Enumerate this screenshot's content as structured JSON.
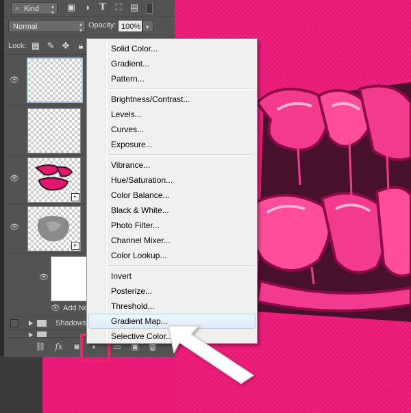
{
  "panel": {
    "filter": {
      "label": "Kind"
    },
    "blend": {
      "mode": "Normal",
      "opacity_label": "Opacity:",
      "opacity_value": "100%"
    },
    "lock": {
      "label": "Lock:"
    },
    "layers": [
      {
        "type": "empty",
        "selected": true
      },
      {
        "type": "empty",
        "selected": false
      },
      {
        "type": "text-art",
        "selected": false
      },
      {
        "type": "shadow-art",
        "selected": false
      }
    ],
    "mask_layer": {
      "label": "Add No"
    },
    "group": {
      "label": "Shadows"
    }
  },
  "menu": {
    "items": [
      {
        "label": "Solid Color..."
      },
      {
        "label": "Gradient..."
      },
      {
        "label": "Pattern..."
      },
      {
        "label": "Brightness/Contrast..."
      },
      {
        "label": "Levels..."
      },
      {
        "label": "Curves..."
      },
      {
        "label": "Exposure..."
      },
      {
        "label": "Vibrance..."
      },
      {
        "label": "Hue/Saturation..."
      },
      {
        "label": "Color Balance..."
      },
      {
        "label": "Black & White..."
      },
      {
        "label": "Photo Filter..."
      },
      {
        "label": "Channel Mixer..."
      },
      {
        "label": "Color Lookup..."
      },
      {
        "label": "Invert"
      },
      {
        "label": "Posterize..."
      },
      {
        "label": "Threshold..."
      },
      {
        "label": "Gradient Map..."
      },
      {
        "label": "Selective Color..."
      }
    ],
    "hovered": "Gradient Map..."
  },
  "colors": {
    "accent": "#f0216f",
    "canvas": "#ee1a7a",
    "panel": "#535353"
  }
}
